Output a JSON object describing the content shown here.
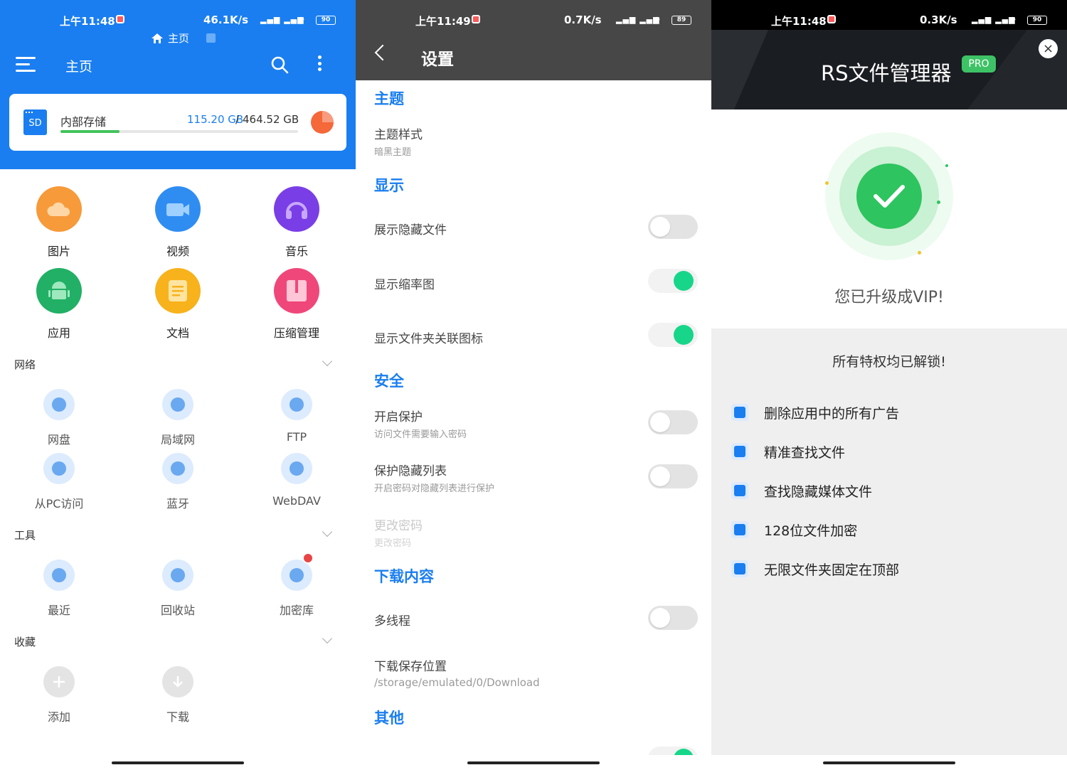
{
  "panel1": {
    "status": {
      "time": "上午11:48",
      "speed": "46.1K/s",
      "battery": "90"
    },
    "breadcrumb": "主页",
    "title": "主页",
    "storage": {
      "name": "内部存储",
      "used": "115.20 GB",
      "separator": "/",
      "total": "464.52 GB",
      "used_fraction": 0.248,
      "sd_label": "SD"
    },
    "categories": [
      {
        "label": "图片",
        "icon": "cloud-photo-icon",
        "color": "#f79a3a"
      },
      {
        "label": "视频",
        "icon": "video-camera-icon",
        "color": "#2f8df2"
      },
      {
        "label": "音乐",
        "icon": "headphones-icon",
        "color": "#7a3ee6"
      },
      {
        "label": "应用",
        "icon": "android-icon",
        "color": "#21b065"
      },
      {
        "label": "文档",
        "icon": "document-icon",
        "color": "#f7b21c"
      },
      {
        "label": "压缩管理",
        "icon": "archive-icon",
        "color": "#f0477a"
      }
    ],
    "sections": {
      "network": "网络",
      "tools": "工具",
      "favorites": "收藏"
    },
    "network_items": [
      "网盘",
      "局域网",
      "FTP",
      "从PC访问",
      "蓝牙",
      "WebDAV"
    ],
    "tool_items": [
      "最近",
      "回收站",
      "加密库"
    ],
    "favorite_items": [
      "添加",
      "下载"
    ]
  },
  "panel2": {
    "status": {
      "time": "上午11:49",
      "speed": "0.7K/s",
      "battery": "89"
    },
    "title": "设置",
    "sections": {
      "theme": "主题",
      "display": "显示",
      "security": "安全",
      "download": "下载内容",
      "other": "其他"
    },
    "items": {
      "theme_style": "主题样式",
      "theme_style_sub": "暗黑主题",
      "show_hidden": "展示隐藏文件",
      "show_thumbs": "显示缩率图",
      "show_folder_icons": "显示文件夹关联图标",
      "enable_protect": "开启保护",
      "enable_protect_sub": "访问文件需要输入密码",
      "protect_hidden": "保护隐藏列表",
      "protect_hidden_sub": "开启密码对隐藏列表进行保护",
      "change_pwd": "更改密码",
      "change_pwd_sub": "更改密码",
      "multithread": "多线程",
      "save_location": "下载保存位置",
      "save_location_sub": "/storage/emulated/0/Download"
    },
    "toggles": {
      "show_hidden": false,
      "show_thumbs": true,
      "show_folder_icons": true,
      "enable_protect": false,
      "protect_hidden": false,
      "multithread": false
    }
  },
  "panel3": {
    "status": {
      "time": "上午11:48",
      "speed": "0.3K/s",
      "battery": "90"
    },
    "title": "RS文件管理器",
    "badge": "PRO",
    "close": "×",
    "vip_text": "您已升级成VIP!",
    "unlock_title": "所有特权均已解锁!",
    "features": [
      "删除应用中的所有广告",
      "精准查找文件",
      "查找隐藏媒体文件",
      "128位文件加密",
      "无限文件夹固定在顶部"
    ]
  }
}
